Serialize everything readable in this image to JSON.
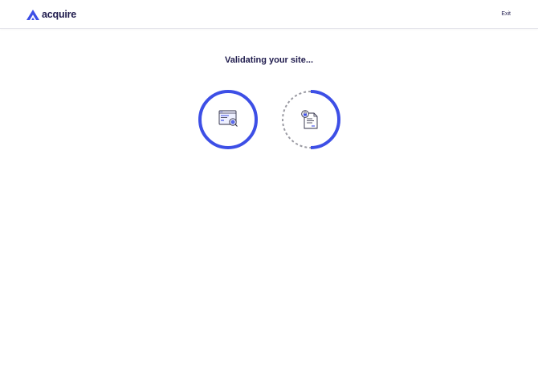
{
  "header": {
    "logo_text": "acquire",
    "exit_label": "Exit"
  },
  "main": {
    "title": "Validating your site...",
    "steps": [
      {
        "name": "site-scan",
        "icon": "browser-search-icon",
        "progress": 1.0,
        "status": "complete"
      },
      {
        "name": "ownership-verification",
        "icon": "locked-document-icon",
        "progress": 0.5,
        "status": "in-progress"
      }
    ]
  },
  "colors": {
    "accent": "#3d4fe6",
    "text": "#1f1b4d",
    "pending": "#9a9aa2"
  }
}
